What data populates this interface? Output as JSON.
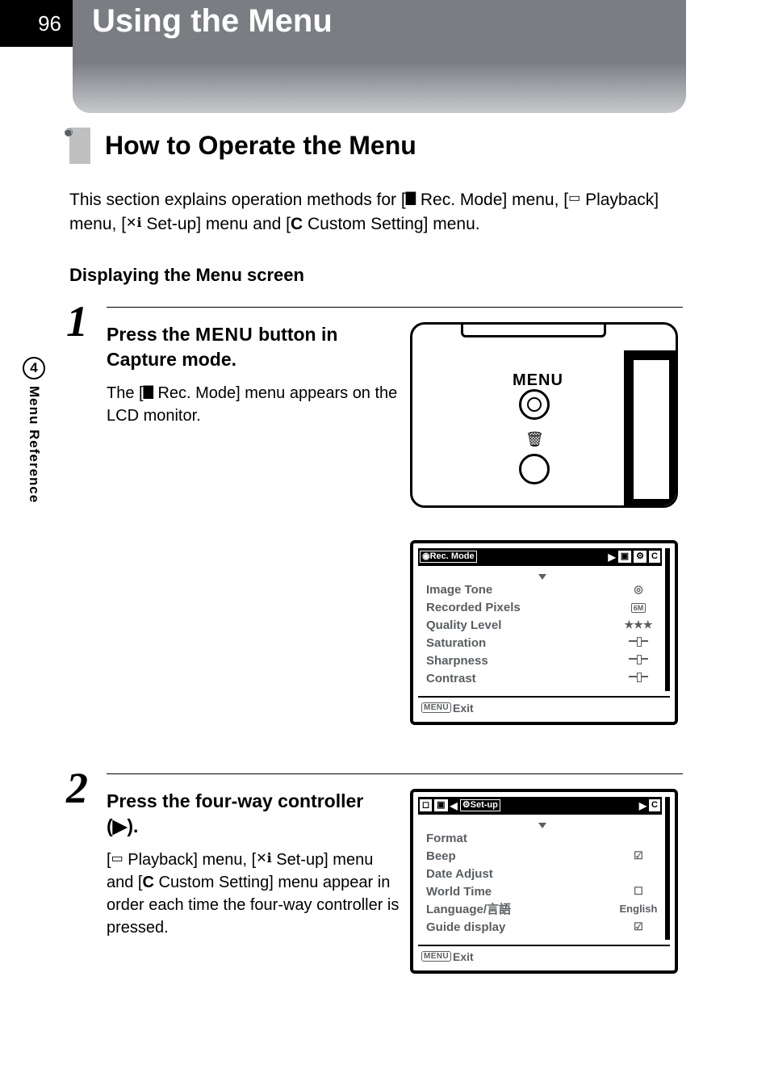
{
  "page_number": "96",
  "chapter": {
    "number": "4",
    "label": "Menu Reference"
  },
  "title": "Using the Menu",
  "section_heading": "How to Operate the Menu",
  "intro": {
    "prefix": "This section explains operation methods for [",
    "rec": " Rec. Mode] menu, [",
    "play": " Playback] menu, [",
    "setup": " Set-up] menu and [",
    "custom_letter": "C",
    "suffix": " Custom Setting] menu."
  },
  "subheading": "Displaying the Menu screen",
  "steps": [
    {
      "num": "1",
      "title_pre": "Press the ",
      "title_menu": "MENU",
      "title_post": " button in Capture mode.",
      "desc_pre": "The [",
      "desc_post": " Rec. Mode] menu appears on the LCD monitor.",
      "camera_label": "MENU",
      "lcd": {
        "title": "Rec. Mode",
        "tabs_right": [
          "▶",
          "▣",
          "⚙",
          "C"
        ],
        "rows": [
          {
            "label": "Image Tone",
            "val": "◎"
          },
          {
            "label": "Recorded Pixels",
            "val": "6M"
          },
          {
            "label": "Quality Level",
            "val": "★★★"
          },
          {
            "label": "Saturation",
            "val": "slider",
            "prefix": "⬢"
          },
          {
            "label": "Sharpness",
            "val": "slider",
            "prefix": "Ⓢ"
          },
          {
            "label": "Contrast",
            "val": "slider",
            "prefix": "◐"
          }
        ],
        "foot_label": "MENU",
        "foot_text": "Exit"
      }
    },
    {
      "num": "2",
      "title": "Press the four-way controller (▶).",
      "desc_parts": {
        "p1": "[",
        "p2": " Playback] menu, [",
        "p3": " Set-up] menu and [",
        "c": "C",
        "p4": " Custom Setting] menu appear in order each time the four-way controller is pressed."
      },
      "lcd": {
        "title": "Set-up",
        "tabs_left": [
          "◻",
          "▣"
        ],
        "tabs_left_arrow": "◀",
        "tabs_right": [
          "▶",
          "C"
        ],
        "rows": [
          {
            "label": "Format",
            "val": ""
          },
          {
            "label": "Beep",
            "val": "☑"
          },
          {
            "label": "Date Adjust",
            "val": ""
          },
          {
            "label": "World Time",
            "val": "☐"
          },
          {
            "label": "Language/言語",
            "val": "English"
          },
          {
            "label": "Guide display",
            "val": "☑"
          }
        ],
        "foot_label": "MENU",
        "foot_text": "Exit"
      }
    }
  ]
}
